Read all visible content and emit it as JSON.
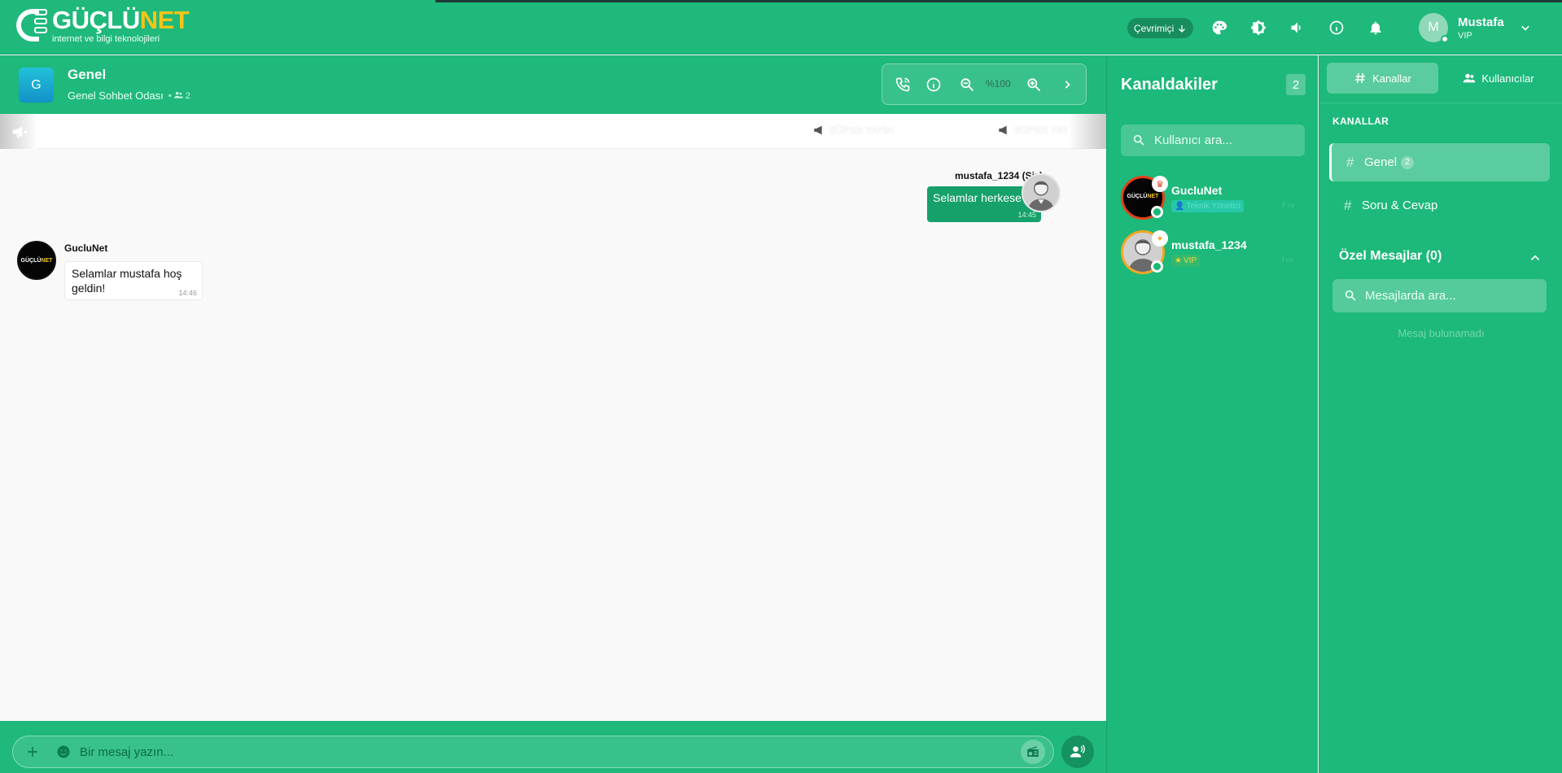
{
  "header": {
    "brand_main": "GÜÇLÜ",
    "brand_accent": "NET",
    "tagline": "internet ve bilgi teknolojileri",
    "status": "Çevrimiçi",
    "user_initial": "M",
    "user_name": "Mustafa",
    "user_role": "VIP"
  },
  "chat": {
    "room_initial": "G",
    "room_title": "Genel",
    "room_subtitle": "Genel Sohbet Odası",
    "room_count": "2",
    "zoom": "%100",
    "ticker": [
      "SÜPER YAYIN",
      "SÜPER YAY"
    ],
    "messages": [
      {
        "author": "mustafa_1234 (Siz)",
        "text": "Selamlar herkese !",
        "time": "14:45",
        "mine": true
      },
      {
        "author": "GucluNet",
        "text": "Selamlar mustafa hoş geldin!",
        "time": "14:46",
        "mine": false
      }
    ],
    "composer_placeholder": "Bir mesaj yazın..."
  },
  "members": {
    "title": "Kanaldakiler",
    "count": "2",
    "search_placeholder": "Kullanıcı ara...",
    "list": [
      {
        "name": "GucluNet",
        "badge": "Teknik Yönetici"
      },
      {
        "name": "mustafa_1234",
        "badge": "VIP"
      }
    ]
  },
  "sidebar": {
    "tab_channels": "Kanallar",
    "tab_users": "Kullanıcılar",
    "section_label": "KANALLAR",
    "channels": [
      {
        "name": "Genel",
        "count": "2"
      },
      {
        "name": "Soru & Cevap"
      }
    ],
    "pm_title": "Özel Mesajlar (0)",
    "pm_search_placeholder": "Mesajlarda ara...",
    "pm_empty": "Mesaj bulunamadı"
  },
  "colors": {
    "primary": "#1eb97b",
    "accent": "#f5c518",
    "bubble_mine": "#16a06a"
  }
}
